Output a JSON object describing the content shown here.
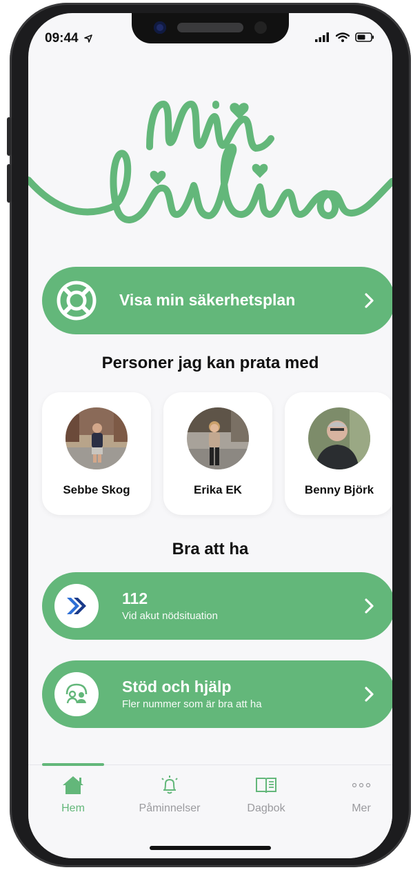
{
  "status": {
    "time": "09:44"
  },
  "safety_plan": {
    "label": "Visa min säkerhetsplan"
  },
  "people": {
    "heading": "Personer jag kan prata med",
    "items": [
      {
        "name": "Sebbe Skog"
      },
      {
        "name": "Erika EK"
      },
      {
        "name": "Benny Björk"
      }
    ]
  },
  "good_to_have": {
    "heading": "Bra att ha",
    "items": [
      {
        "title": "112",
        "subtitle": "Vid akut nödsituation"
      },
      {
        "title": "Stöd och hjälp",
        "subtitle": "Fler nummer som är bra att ha"
      }
    ]
  },
  "tabs": [
    {
      "label": "Hem",
      "icon": "home-icon"
    },
    {
      "label": "Påminnelser",
      "icon": "bell-icon"
    },
    {
      "label": "Dagbok",
      "icon": "book-icon"
    },
    {
      "label": "Mer",
      "icon": "more-icon"
    }
  ],
  "colors": {
    "accent": "#63b77a",
    "inactive": "#9a9a9e"
  }
}
